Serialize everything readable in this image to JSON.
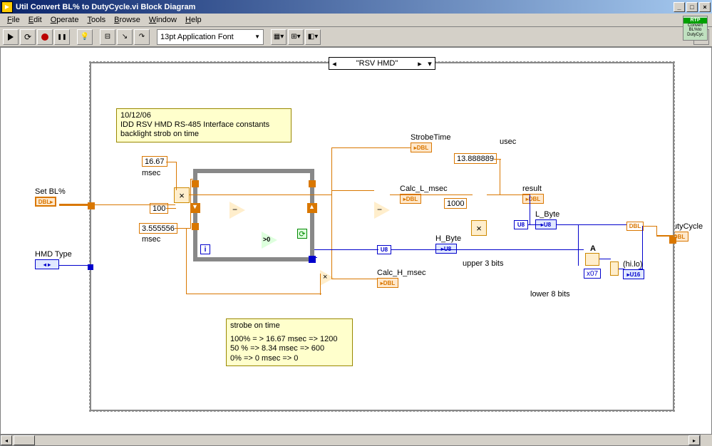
{
  "window": {
    "title": "Util Convert BL% to DutyCycle.vi Block Diagram"
  },
  "menu": {
    "file": "File",
    "edit": "Edit",
    "operate": "Operate",
    "tools": "Tools",
    "browse": "Browse",
    "window": "Window",
    "help": "Help"
  },
  "toolbar": {
    "font": "13pt Application Font"
  },
  "logo": {
    "line1": "RTP",
    "line2": "Convert",
    "line3": "BL%to",
    "line4": "DutyCyc"
  },
  "case": {
    "selector": "\"RSV HMD\""
  },
  "comment1": {
    "l1": "10/12/06",
    "l2": "IDD RSV HMD RS-485 Interface constants",
    "l3": "backlight strob on time"
  },
  "comment2": {
    "l1": "strobe on time",
    "l2": "100% = > 16.67 msec => 1200",
    "l3": "50 % => 8.34  msec => 600",
    "l4": "0% => 0 msec  => 0"
  },
  "controls": {
    "setbl": "Set BL%",
    "hmdtype": "HMD Type",
    "dutycycle": "DutyCycle"
  },
  "indicators": {
    "strobetime": "StrobeTime",
    "calcL": "Calc_L_msec",
    "calcH": "Calc_H_msec",
    "hbyte": "H_Byte",
    "lbyte": "L_Byte",
    "result": "result",
    "usec": "usec",
    "hilo": "(hi.lo)"
  },
  "consts": {
    "c1667": "16.67",
    "msec1": "msec",
    "c100": "100",
    "c355": "3.555556",
    "msec2": "msec",
    "c1388": "13.888889",
    "c1000": "1000",
    "mask": "x07"
  },
  "text": {
    "upper3": "upper 3 bits",
    "lower8": "lower 8 bits",
    "A": "A"
  },
  "typelabels": {
    "dbl": "DBL",
    "u8": "U8",
    "u16": "U16",
    "i": "i"
  }
}
